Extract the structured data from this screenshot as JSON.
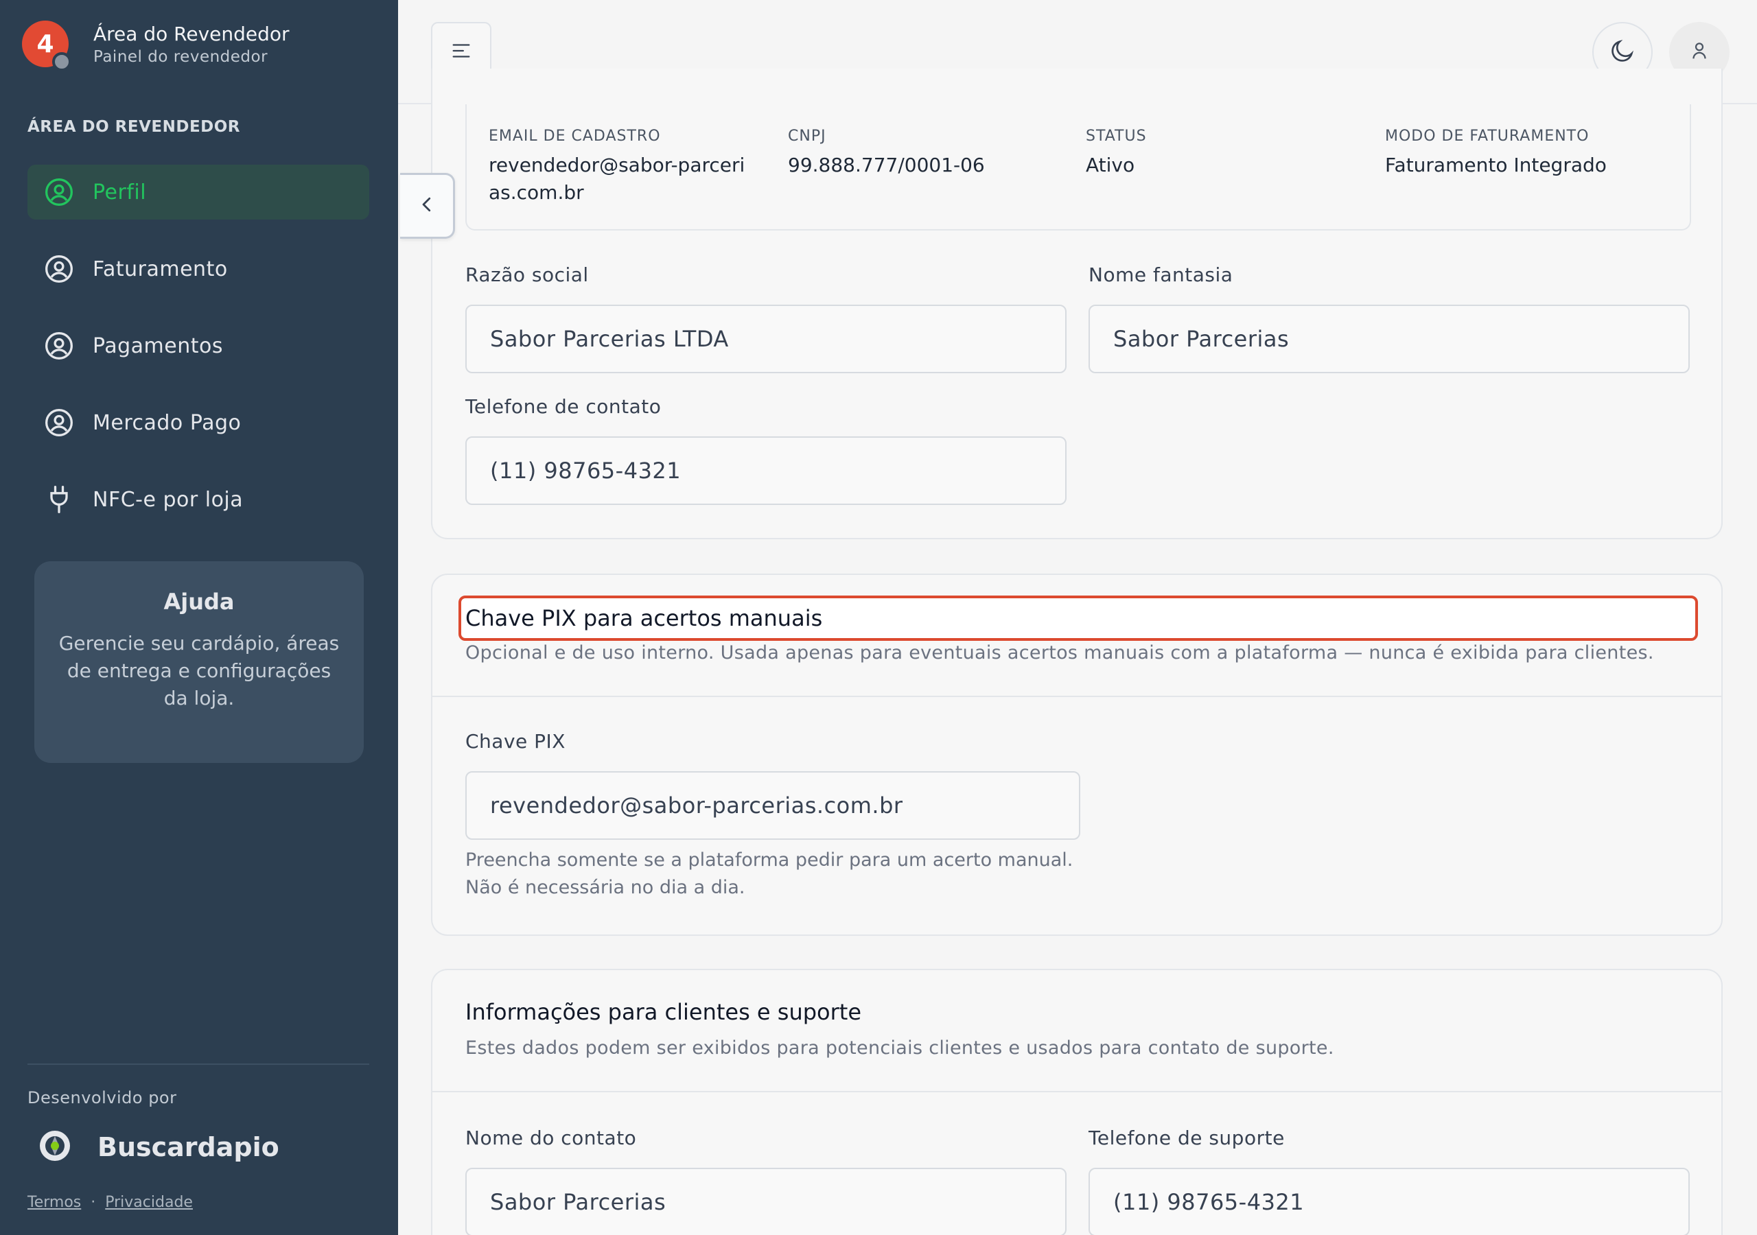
{
  "sidebar": {
    "brand_badge": "4",
    "brand_title": "Área do Revendedor",
    "brand_subtitle": "Painel do revendedor",
    "section_label": "ÁREA DO REVENDEDOR",
    "items": [
      {
        "label": "Perfil",
        "icon": "user-circle-icon",
        "active": true
      },
      {
        "label": "Faturamento",
        "icon": "user-circle-icon",
        "active": false
      },
      {
        "label": "Pagamentos",
        "icon": "user-circle-icon",
        "active": false
      },
      {
        "label": "Mercado Pago",
        "icon": "user-circle-icon",
        "active": false
      },
      {
        "label": "NFC-e por loja",
        "icon": "plug-icon",
        "active": false
      }
    ],
    "help": {
      "title": "Ajuda",
      "text": "Gerencie seu cardápio, áreas de entrega e configurações da loja."
    },
    "developed_by": "Desenvolvido por",
    "developer_name": "Buscardapio",
    "footer_links": [
      "Termos",
      "Privacidade"
    ],
    "footer_separator": "·"
  },
  "topbar": {
    "menu_icon": "menu-icon",
    "theme_icon": "moon-icon",
    "user_icon": "user-icon"
  },
  "profile": {
    "info": [
      {
        "label": "EMAIL DE CADASTRO",
        "value": "revendedor@sabor-parcerias.com.br"
      },
      {
        "label": "CNPJ",
        "value": "99.888.777/0001-06"
      },
      {
        "label": "STATUS",
        "value": "Ativo"
      },
      {
        "label": "MODO DE FATURAMENTO",
        "value": "Faturamento Integrado"
      }
    ],
    "razao_social_label": "Razão social",
    "razao_social_value": "Sabor Parcerias LTDA",
    "nome_fantasia_label": "Nome fantasia",
    "nome_fantasia_value": "Sabor Parcerias",
    "telefone_label": "Telefone de contato",
    "telefone_value": "(11) 98765-4321"
  },
  "pix": {
    "title": "Chave PIX para acertos manuais",
    "description": "Opcional e de uso interno. Usada apenas para eventuais acertos manuais com a plataforma — nunca é exibida para clientes.",
    "field_label": "Chave PIX",
    "field_value": "revendedor@sabor-parcerias.com.br",
    "hint_line1": "Preencha somente se a plataforma pedir para um acerto manual.",
    "hint_line2": "Não é necessária no dia a dia."
  },
  "support": {
    "title": "Informações para clientes e suporte",
    "description": "Estes dados podem ser exibidos para potenciais clientes e usados para contato de suporte.",
    "contact_name_label": "Nome do contato",
    "contact_name_value": "Sabor Parcerias",
    "support_phone_label": "Telefone de suporte",
    "support_phone_value": "(11) 98765-4321"
  },
  "colors": {
    "sidebar_bg": "#2c3e50",
    "active_green": "#22c55e",
    "badge_red": "#e24a33",
    "highlight_red": "#dc4a2f"
  }
}
